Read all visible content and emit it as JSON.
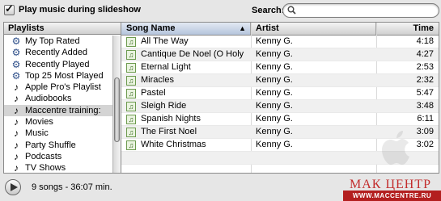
{
  "toolbar": {
    "checkbox_label": "Play music during slideshow",
    "checkbox_checked": true,
    "search_label": "Search:",
    "search_value": ""
  },
  "playlists": {
    "header": "Playlists",
    "items": [
      {
        "label": "My Top Rated",
        "icon": "smart-playlist-icon"
      },
      {
        "label": "Recently Added",
        "icon": "smart-playlist-icon"
      },
      {
        "label": "Recently Played",
        "icon": "smart-playlist-icon"
      },
      {
        "label": "Top 25 Most Played",
        "icon": "smart-playlist-icon"
      },
      {
        "label": "Apple Pro's Playlist",
        "icon": "playlist-icon"
      },
      {
        "label": "Audiobooks",
        "icon": "playlist-icon"
      },
      {
        "label": "Maccentre training:",
        "icon": "playlist-icon",
        "selected": true
      },
      {
        "label": "Movies",
        "icon": "playlist-icon"
      },
      {
        "label": "Music",
        "icon": "playlist-icon"
      },
      {
        "label": "Party Shuffle",
        "icon": "playlist-icon"
      },
      {
        "label": "Podcasts",
        "icon": "playlist-icon"
      },
      {
        "label": "TV Shows",
        "icon": "playlist-icon"
      }
    ]
  },
  "songs": {
    "columns": {
      "name": "Song Name",
      "artist": "Artist",
      "time": "Time"
    },
    "rows": [
      {
        "name": "All The Way",
        "artist": "Kenny G.",
        "time": "4:18"
      },
      {
        "name": "Cantique De Noel (O Holy",
        "artist": "Kenny G.",
        "time": "4:27"
      },
      {
        "name": "Eternal Light",
        "artist": "Kenny G.",
        "time": "2:53"
      },
      {
        "name": "Miracles",
        "artist": "Kenny G.",
        "time": "2:32"
      },
      {
        "name": "Pastel",
        "artist": "Kenny G.",
        "time": "5:47"
      },
      {
        "name": "Sleigh Ride",
        "artist": "Kenny G.",
        "time": "3:48"
      },
      {
        "name": "Spanish Nights",
        "artist": "Kenny G.",
        "time": "6:11"
      },
      {
        "name": "The First Noel",
        "artist": "Kenny G.",
        "time": "3:09"
      },
      {
        "name": "White Christmas",
        "artist": "Kenny G.",
        "time": "3:02"
      }
    ]
  },
  "status": {
    "summary": "9 songs - 36:07 min."
  },
  "watermark": {
    "brand": "МАК ЦЕНТР",
    "url": "WWW.MACCENTRE.RU",
    "color": "#c32d2d"
  }
}
